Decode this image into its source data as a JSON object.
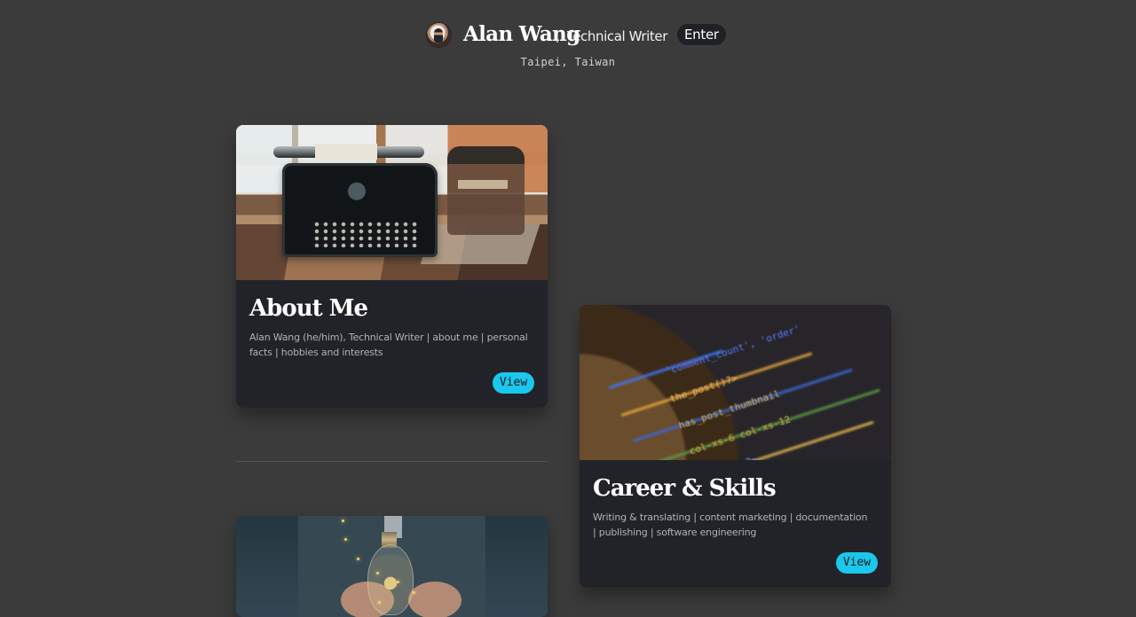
{
  "header": {
    "name": "Alan Wang",
    "separator": "|",
    "role": "Technical Writer",
    "enter_label": "Enter",
    "location": "Taipei, Taiwan"
  },
  "cards": [
    {
      "title": "About Me",
      "description": "Alan Wang (he/him), Technical Writer | about me | personal facts | hobbies and interests",
      "button_label": "View"
    },
    {
      "title": "Career & Skills",
      "description": "Writing & translating | content marketing | documentation | publishing | software engineering",
      "button_label": "View"
    }
  ],
  "colors": {
    "background": "#3b3b3b",
    "card": "#212328",
    "button": "#1bc8ed",
    "muted_text": "#aeb2b8"
  },
  "icons": {
    "avatar": "profile-photo",
    "about_image": "typewriter-image",
    "career_image": "code-screen-image",
    "third_image": "light-bulb-image"
  }
}
